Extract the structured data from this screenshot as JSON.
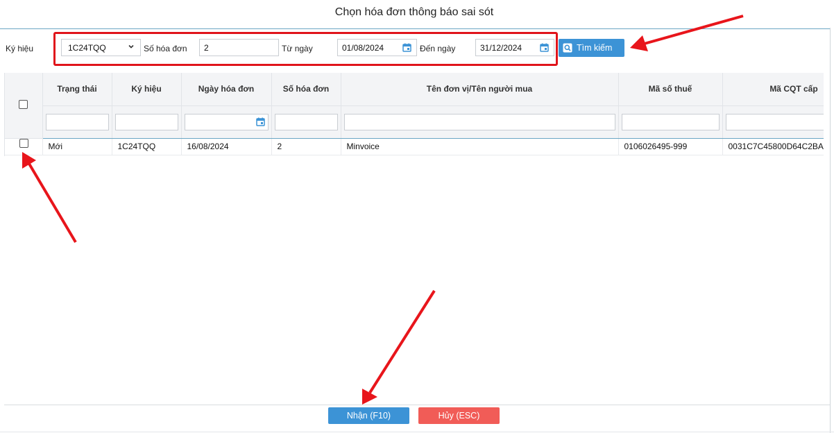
{
  "dialog": {
    "title": "Chọn hóa đơn thông báo sai sót"
  },
  "filters": {
    "symbol_label": "Ký hiệu",
    "symbol_value": "1C24TQQ",
    "invoice_no_label": "Số hóa đơn",
    "invoice_no_value": "2",
    "from_date_label": "Từ ngày",
    "from_date_value": "01/08/2024",
    "to_date_label": "Đến ngày",
    "to_date_value": "31/12/2024",
    "search_label": "Tìm kiếm"
  },
  "table": {
    "columns": [
      "Trạng thái",
      "Ký hiệu",
      "Ngày hóa đơn",
      "Số hóa đơn",
      "Tên đơn vị/Tên người mua",
      "Mã số thuế",
      "Mã CQT cấp"
    ],
    "rows": [
      [
        "Mới",
        "1C24TQQ",
        "16/08/2024",
        "2",
        "Minvoice",
        "0106026495-999",
        "0031C7C45800D64C2BA"
      ]
    ]
  },
  "footer": {
    "ok_label": "Nhận (F10)",
    "cancel_label": "Hủy (ESC)"
  },
  "colors": {
    "accent": "#3c93d6",
    "danger": "#f15c57",
    "annotation": "#e0141b"
  }
}
